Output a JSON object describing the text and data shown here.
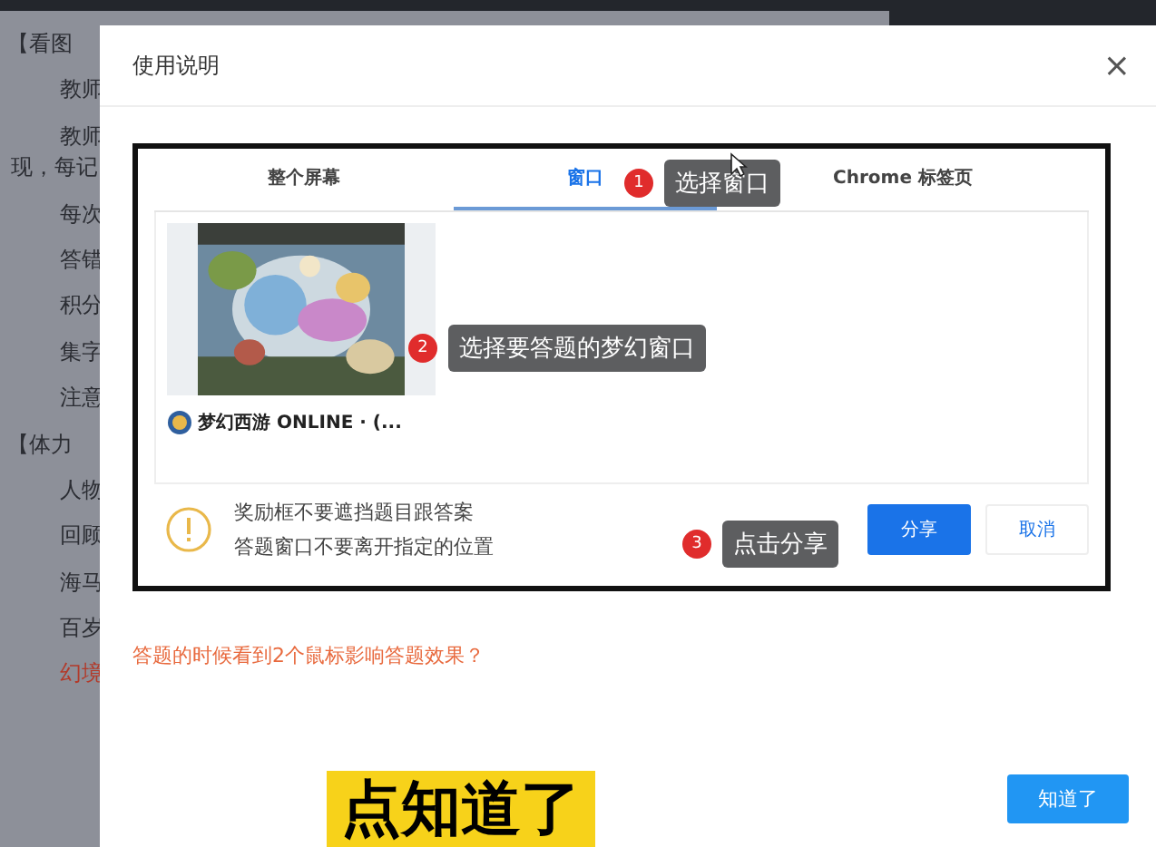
{
  "background_page": {
    "lines": [
      {
        "text": "【看图",
        "kind": "heading"
      },
      {
        "text": "教师",
        "kind": "item"
      },
      {
        "text": "教师",
        "kind": "item"
      },
      {
        "text": "现，每记",
        "kind": "wrap"
      },
      {
        "text": "每次",
        "kind": "item"
      },
      {
        "text": "答错",
        "kind": "item"
      },
      {
        "text": "积分",
        "kind": "item"
      },
      {
        "text": "集字",
        "kind": "item"
      },
      {
        "text": "注意",
        "kind": "item"
      },
      {
        "text": "【体力",
        "kind": "heading"
      },
      {
        "text": "人物",
        "kind": "item"
      },
      {
        "text": "回顾",
        "kind": "item"
      },
      {
        "text": "海马",
        "kind": "item"
      },
      {
        "text": "百岁",
        "kind": "item"
      },
      {
        "text": "幻境",
        "kind": "alert"
      }
    ]
  },
  "dialog": {
    "title": "使用说明",
    "close": "×",
    "share_picker": {
      "tabs": [
        {
          "label": "整个屏幕",
          "selected": false
        },
        {
          "label": "窗口",
          "selected": true
        },
        {
          "label": "Chrome 标签页",
          "selected": false
        }
      ],
      "source": {
        "kind": "picture",
        "caption": "梦幻西游 ONLINE · (..."
      },
      "warning": [
        "奖励框不要遮挡题目跟答案",
        "答题窗口不要离开指定的位置"
      ],
      "buttons": [
        {
          "label": "分享",
          "primary": true
        },
        {
          "label": "取消",
          "primary": false
        }
      ],
      "callouts": [
        {
          "number": "1",
          "text": "选择窗口"
        },
        {
          "number": "2",
          "text": "选择要答题的梦幻窗口"
        },
        {
          "number": "3",
          "text": "点击分享"
        }
      ]
    },
    "help_link": "答题的时候看到2个鼠标影响答题效果？",
    "confirm_button": "知道了"
  },
  "subtitle": "点知道了"
}
